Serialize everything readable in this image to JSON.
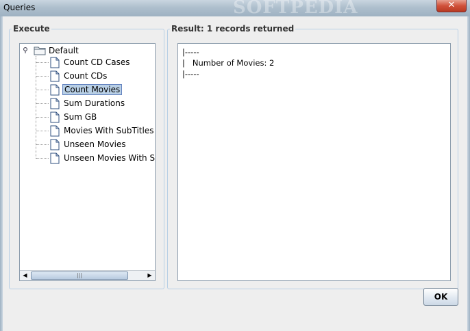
{
  "window": {
    "title": "Queries",
    "watermark": "SOFTPEDIA",
    "close_label": "✕"
  },
  "execute_panel": {
    "legend": "Execute",
    "tree": {
      "root_label": "Default",
      "items": [
        {
          "label": "Count CD Cases"
        },
        {
          "label": "Count CDs"
        },
        {
          "label": "Count Movies"
        },
        {
          "label": "Sum Durations"
        },
        {
          "label": "Sum GB"
        },
        {
          "label": "Movies With SubTitles"
        },
        {
          "label": "Unseen Movies"
        },
        {
          "label": "Unseen Movies With Sub"
        }
      ],
      "selected": "Count Movies"
    },
    "scrollbar": {
      "left_arrow": "◀",
      "right_arrow": "▶",
      "grip": "|||"
    }
  },
  "result_panel": {
    "legend": "Result: 1 records returned",
    "lines": [
      "|-----",
      "|   Number of Movies: 2",
      "|-----"
    ]
  },
  "footer": {
    "ok_label": "OK"
  },
  "colors": {
    "selection": "#b8cfe5",
    "border_accent": "#b8cfe5",
    "close_button": "#c94a33"
  },
  "icons": [
    "collapse-toggle-icon",
    "folder-icon",
    "document-icon",
    "close-icon"
  ]
}
